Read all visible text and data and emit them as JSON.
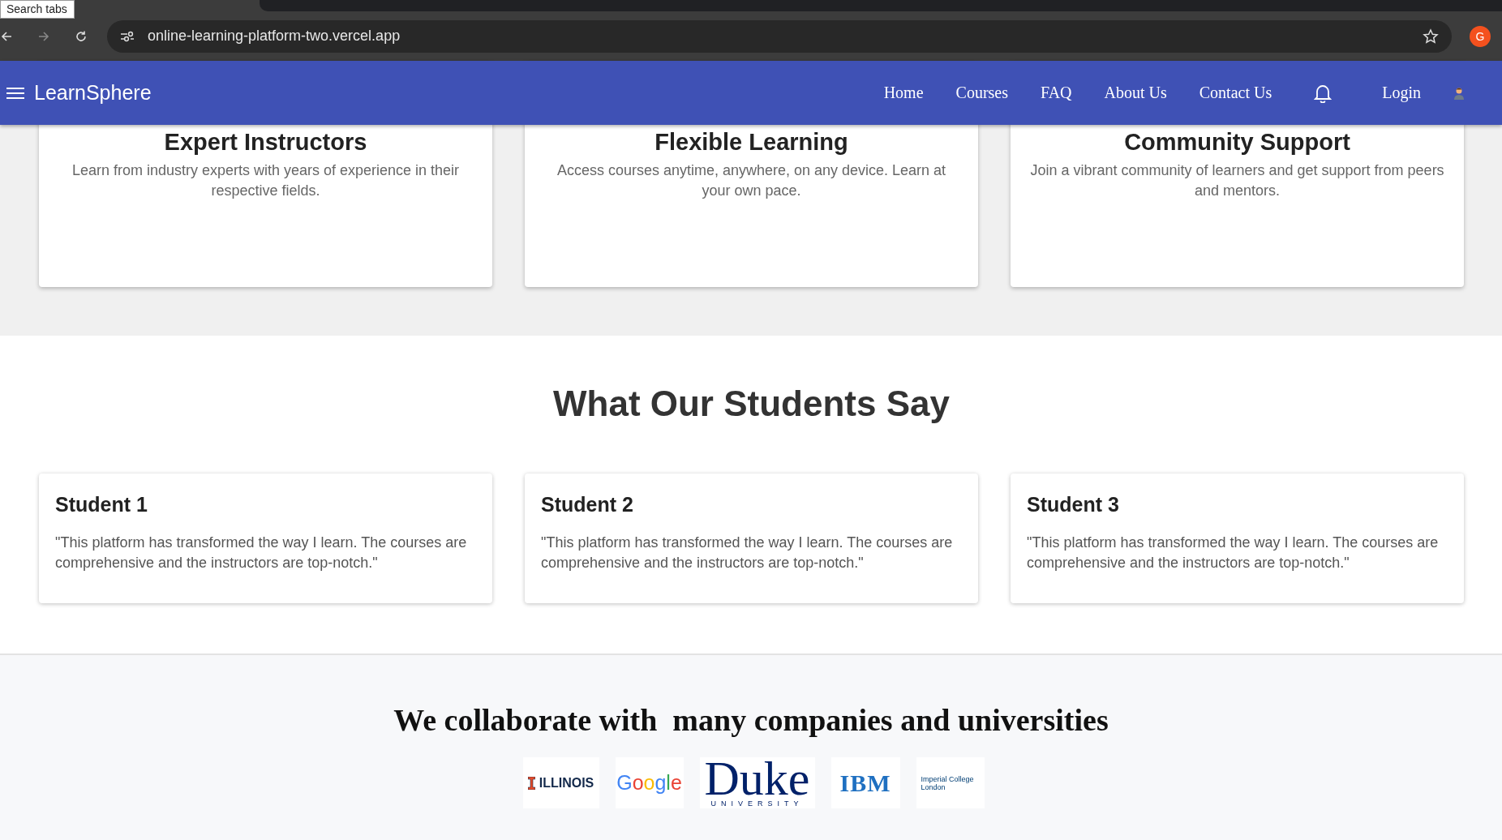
{
  "browser": {
    "tooltip": "Search tabs",
    "url": "online-learning-platform-two.vercel.app",
    "profile_initial": "G"
  },
  "navbar": {
    "brand": "LearnSphere",
    "links": [
      "Home",
      "Courses",
      "FAQ",
      "About Us",
      "Contact Us"
    ],
    "login": "Login"
  },
  "features": [
    {
      "title": "Expert Instructors",
      "text": "Learn from industry experts with years of experience in their respective fields."
    },
    {
      "title": "Flexible Learning",
      "text": "Access courses anytime, anywhere, on any device. Learn at your own pace."
    },
    {
      "title": "Community Support",
      "text": "Join a vibrant community of learners and get support from peers and mentors."
    }
  ],
  "testimonials": {
    "heading": "What Our Students Say",
    "items": [
      {
        "name": "Student 1",
        "quote": "\"This platform has transformed the way I learn. The courses are comprehensive and the instructors are top-notch.\""
      },
      {
        "name": "Student 2",
        "quote": "\"This platform has transformed the way I learn. The courses are comprehensive and the instructors are top-notch.\""
      },
      {
        "name": "Student 3",
        "quote": "\"This platform has transformed the way I learn. The courses are comprehensive and the instructors are top-notch.\""
      }
    ]
  },
  "partners": {
    "heading": "We collaborate with  many companies and universities",
    "logos": [
      {
        "kind": "illinois",
        "text": "ILLINOIS"
      },
      {
        "kind": "google",
        "text": "Google"
      },
      {
        "kind": "duke",
        "text": "Duke",
        "subtext": "UNIVERSITY"
      },
      {
        "kind": "ibm",
        "text": "IBM"
      },
      {
        "kind": "imperial",
        "text": "Imperial College London"
      }
    ]
  }
}
